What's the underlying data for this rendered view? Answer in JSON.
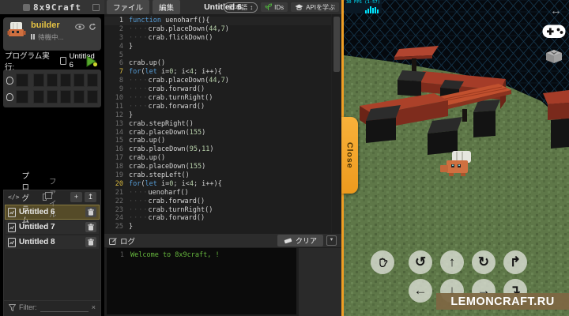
{
  "sidebar": {
    "logo": "8x9Craft",
    "user": {
      "name": "builder",
      "status": "待機中..."
    },
    "run": {
      "label": "プログラム実行:",
      "file": "Untitled 6"
    },
    "files_panel": {
      "tab_program": "プログラム",
      "tab_file": "ファイル",
      "add_icon": "+",
      "upload_icon": "↥",
      "files": [
        {
          "name": "Untitled 6",
          "selected": true
        },
        {
          "name": "Untitled 7",
          "selected": false
        },
        {
          "name": "Untitled 8",
          "selected": false
        }
      ],
      "filter_label": "Filter:",
      "clear_filter_icon": "×"
    }
  },
  "editor": {
    "menu_file": "ファイル",
    "menu_edit": "編集",
    "title": "Untitled 6",
    "language_select": "日本語",
    "lang_arrow_icon": "↕",
    "ids_button": "IDs",
    "api_button": "APIを学ぶ",
    "code": [
      {
        "n": 1,
        "g": "active",
        "s": [
          [
            "k",
            "function"
          ],
          [
            "p",
            " uenoharf(){"
          ]
        ]
      },
      {
        "n": 2,
        "s": [
          [
            "w",
            "····"
          ],
          [
            "p",
            "crab.placeDown("
          ],
          [
            "n",
            "44"
          ],
          [
            "p",
            ","
          ],
          [
            "n",
            "7"
          ],
          [
            "p",
            ")"
          ]
        ]
      },
      {
        "n": 3,
        "s": [
          [
            "w",
            "····"
          ],
          [
            "p",
            "crab.flickDown()"
          ]
        ]
      },
      {
        "n": 4,
        "s": [
          [
            "p",
            "}"
          ]
        ]
      },
      {
        "n": 5,
        "s": []
      },
      {
        "n": 6,
        "s": [
          [
            "p",
            "crab.up()"
          ]
        ]
      },
      {
        "n": 7,
        "g": "hl",
        "s": [
          [
            "k",
            "for"
          ],
          [
            "p",
            "("
          ],
          [
            "k",
            "let"
          ],
          [
            "p",
            " i="
          ],
          [
            "n",
            "0"
          ],
          [
            "p",
            "; i<"
          ],
          [
            "n",
            "4"
          ],
          [
            "p",
            "; i++){"
          ]
        ]
      },
      {
        "n": 8,
        "s": [
          [
            "w",
            "····"
          ],
          [
            "p",
            "crab.placeDown("
          ],
          [
            "n",
            "44"
          ],
          [
            "p",
            ","
          ],
          [
            "n",
            "7"
          ],
          [
            "p",
            ")"
          ]
        ]
      },
      {
        "n": 9,
        "s": [
          [
            "w",
            "····"
          ],
          [
            "p",
            "crab.forward()"
          ]
        ]
      },
      {
        "n": 10,
        "s": [
          [
            "w",
            "····"
          ],
          [
            "p",
            "crab.turnRight()"
          ]
        ]
      },
      {
        "n": 11,
        "s": [
          [
            "w",
            "····"
          ],
          [
            "p",
            "crab.forward()"
          ]
        ]
      },
      {
        "n": 12,
        "s": [
          [
            "p",
            "}"
          ]
        ]
      },
      {
        "n": 13,
        "s": [
          [
            "p",
            "crab.stepRight()"
          ]
        ]
      },
      {
        "n": 14,
        "s": [
          [
            "p",
            "crab.placeDown("
          ],
          [
            "n",
            "155"
          ],
          [
            "p",
            ")"
          ]
        ]
      },
      {
        "n": 15,
        "s": [
          [
            "p",
            "crab.up()"
          ]
        ]
      },
      {
        "n": 16,
        "s": [
          [
            "p",
            "crab.placeDown("
          ],
          [
            "n",
            "95"
          ],
          [
            "p",
            ","
          ],
          [
            "n",
            "11"
          ],
          [
            "p",
            ")"
          ]
        ]
      },
      {
        "n": 17,
        "s": [
          [
            "p",
            "crab.up()"
          ]
        ]
      },
      {
        "n": 18,
        "s": [
          [
            "p",
            "crab.placeDown("
          ],
          [
            "n",
            "155"
          ],
          [
            "p",
            ")"
          ]
        ]
      },
      {
        "n": 19,
        "s": [
          [
            "p",
            "crab.stepLeft()"
          ]
        ]
      },
      {
        "n": 20,
        "g": "hl",
        "s": [
          [
            "k",
            "for"
          ],
          [
            "p",
            "("
          ],
          [
            "k",
            "let"
          ],
          [
            "p",
            " i="
          ],
          [
            "n",
            "0"
          ],
          [
            "p",
            "; i<"
          ],
          [
            "n",
            "4"
          ],
          [
            "p",
            "; i++){"
          ]
        ]
      },
      {
        "n": 21,
        "s": [
          [
            "w",
            "····"
          ],
          [
            "p",
            "uenoharf()"
          ]
        ]
      },
      {
        "n": 22,
        "s": [
          [
            "w",
            "····"
          ],
          [
            "p",
            "crab.forward()"
          ]
        ]
      },
      {
        "n": 23,
        "s": [
          [
            "w",
            "····"
          ],
          [
            "p",
            "crab.turnRight()"
          ]
        ]
      },
      {
        "n": 24,
        "s": [
          [
            "w",
            "····"
          ],
          [
            "p",
            "crab.forward()"
          ]
        ]
      },
      {
        "n": 25,
        "s": [
          [
            "p",
            "}"
          ]
        ]
      }
    ],
    "log": {
      "title": "ログ",
      "clear_button": "クリア",
      "collapse_icon": "▾",
      "lines": [
        {
          "n": "1",
          "text": "Welcome to 8x9craft, !"
        }
      ]
    }
  },
  "game": {
    "fps_text": "30 FPS (1-57)",
    "close_tab": "Close",
    "watermark": "LEMONCRAFT.RU",
    "resize_icon": "↔",
    "controls": {
      "row1": [
        {
          "name": "pan",
          "icon": "hand"
        },
        {
          "name": "rotate-ccw",
          "icon": "↺"
        },
        {
          "name": "move-up",
          "icon": "↑"
        },
        {
          "name": "rotate-cw",
          "icon": "↻"
        },
        {
          "name": "turn-up-right",
          "icon": "↱"
        }
      ],
      "row2": [
        {
          "name": "move-left",
          "icon": "←"
        },
        {
          "name": "move-down",
          "icon": "↓"
        },
        {
          "name": "move-right",
          "icon": "→"
        },
        {
          "name": "turn-down-right",
          "icon": "↴"
        }
      ]
    },
    "colors": {
      "accent_orange": "#ef9e24",
      "sky": "#05090e",
      "grid_line": "#16384f",
      "grass": "#5e7748",
      "red_block": "#a53c28",
      "black_block": "#161616",
      "log_green": "#67b93e",
      "selected_file": "#554b28"
    }
  }
}
